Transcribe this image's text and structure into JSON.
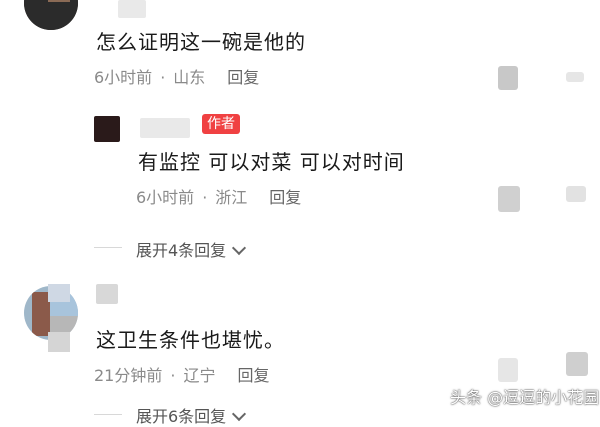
{
  "comments": [
    {
      "text": "怎么证明这一碗是他的",
      "time": "6小时前",
      "location": "山东",
      "reply_label": "回复"
    },
    {
      "badge": "作者",
      "text": "有监控 可以对菜 可以对时间",
      "time": "6小时前",
      "location": "浙江",
      "reply_label": "回复"
    },
    {
      "text": "这卫生条件也堪忧。",
      "time": "21分钟前",
      "location": "辽宁",
      "reply_label": "回复"
    }
  ],
  "expand": [
    {
      "label": "展开4条回复"
    },
    {
      "label": "展开6条回复"
    }
  ],
  "separator": "·",
  "watermark": "头条 @逗逗的小花园",
  "colors": {
    "badge": "#f04142",
    "meta": "#8a8a8a",
    "text": "#1a1a1a"
  },
  "icons": [
    "avatar",
    "like-icon",
    "chevron-down-icon"
  ]
}
